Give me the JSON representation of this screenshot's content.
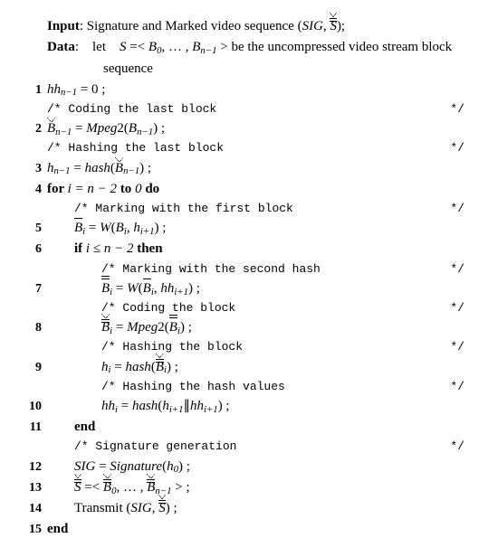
{
  "header": {
    "input_label": "Input",
    "input_text": ": Signature and Marked video sequence (",
    "sig": "SIG",
    "s_sym": "S",
    "close": ");",
    "data_label": "Data",
    "data_text": ": let ",
    "data_s": "S",
    "data_eq": " =< ",
    "data_b0": "B",
    "data_b0_sub": "0",
    "data_dots": ", … , ",
    "data_bn": "B",
    "data_bn_sub": "n−1",
    "data_close": " > be the uncompressed video stream block",
    "data_line2": "sequence"
  },
  "lines": {
    "l1": {
      "no": "1",
      "hh": "hh",
      "hh_sub": "n−1",
      "eq": " = 0 ;"
    },
    "c1": {
      "open": "/* ",
      "text": "Coding the last block",
      "end": "*/"
    },
    "l2": {
      "no": "2",
      "bhat": "B",
      "bhat_sub": "n−1",
      "eq": " = ",
      "fn": "Mpeg",
      "fnnum": "2(",
      "arg": "B",
      "arg_sub": "n−1",
      "close": ") ;"
    },
    "c2": {
      "open": "/* ",
      "text": "Hashing the last block",
      "end": "*/"
    },
    "l3": {
      "no": "3",
      "h": "h",
      "h_sub": "n−1",
      "eq": " = ",
      "fn": "hash",
      "open": "(",
      "arg": "B",
      "arg_sub": "n−1",
      "close": ") ;"
    },
    "l4": {
      "no": "4",
      "for": "for ",
      "i": "i = n − 2 ",
      "to": "to ",
      "zero": "0 ",
      "do": "do"
    },
    "c3": {
      "open": "/* ",
      "text": "Marking with the first block",
      "end": "*/"
    },
    "l5": {
      "no": "5",
      "bbar": "B",
      "b_sub": "i",
      "eq": " = ",
      "fn": "W",
      "open": "(",
      "a1": "B",
      "a1_sub": "i",
      "comma": ", ",
      "a2": "h",
      "a2_sub": "i+1",
      "close": ") ;"
    },
    "l6": {
      "no": "6",
      "if": "if ",
      "cond": "i ≤ n − 2 ",
      "then": "then"
    },
    "c4": {
      "open": "/* ",
      "text": "Marking with the second hash",
      "end": "*/"
    },
    "l7": {
      "no": "7",
      "bdbar": "B",
      "b_sub": "i",
      "eq": " = ",
      "fn": "W",
      "open": "(",
      "a1": "B",
      "a1_sub": "i",
      "comma": ", ",
      "a2": "hh",
      "a2_sub": "i+1",
      "close": ") ;"
    },
    "c5": {
      "open": "/* ",
      "text": "Coding the block",
      "end": "*/"
    },
    "l8": {
      "no": "8",
      "bhb": "B",
      "b_sub": "i",
      "eq": " = ",
      "fn": "Mpeg",
      "fnnum": "2(",
      "arg": "B",
      "arg_sub": "i",
      "close": ") ;"
    },
    "c6": {
      "open": "/* ",
      "text": "Hashing the block",
      "end": "*/"
    },
    "l9": {
      "no": "9",
      "h": "h",
      "h_sub": "i",
      "eq": " = ",
      "fn": "hash",
      "open": "(",
      "arg": "B",
      "arg_sub": "i",
      "close": ") ;"
    },
    "c7": {
      "open": "/* ",
      "text": "Hashing the hash values",
      "end": "*/"
    },
    "l10": {
      "no": "10",
      "hh": "hh",
      "hh_sub": "i",
      "eq": " = ",
      "fn": "hash",
      "open": "(",
      "a1": "h",
      "a1_sub": "i+1",
      "bar": "∥",
      "a2": "hh",
      "a2_sub": "i+1",
      "close": ") ;"
    },
    "l11": {
      "no": "11",
      "end": "end"
    },
    "c8": {
      "open": "/* ",
      "text": "Signature generation",
      "end": "*/"
    },
    "l12": {
      "no": "12",
      "sig": "SIG",
      "eq": " = ",
      "fn": "Signature",
      "open": "(",
      "arg": "h",
      "arg_sub": "0",
      "close": ") ;"
    },
    "l13": {
      "no": "13",
      "s": "S",
      "eq": " =< ",
      "b0": "B",
      "b0_sub": "0",
      "dots": ", … , ",
      "bn": "B",
      "bn_sub": "n−1",
      "close": " > ;"
    },
    "l14": {
      "no": "14",
      "tx": "Transmit (",
      "sig": "SIG",
      "comma": ", ",
      "s": "S",
      "close": ") ;"
    },
    "l15": {
      "no": "15",
      "end": "end"
    }
  }
}
